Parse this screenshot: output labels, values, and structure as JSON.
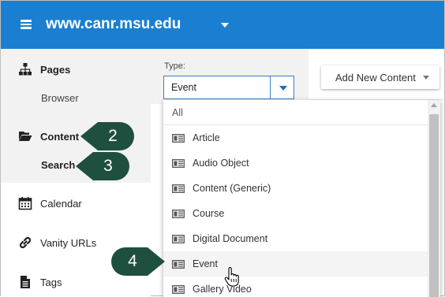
{
  "header": {
    "site_title": "www.canr.msu.edu"
  },
  "sidebar": {
    "items": [
      {
        "label": "Pages",
        "icon": "sitemap-icon"
      },
      {
        "label": "Browser"
      },
      {
        "label": "Content",
        "icon": "folder-open-icon"
      },
      {
        "label": "Search"
      },
      {
        "label": "Calendar",
        "icon": "calendar-icon"
      },
      {
        "label": "Vanity URLs",
        "icon": "link-icon"
      },
      {
        "label": "Tags",
        "icon": "document-icon"
      }
    ]
  },
  "callouts": [
    "2",
    "3",
    "4"
  ],
  "filter": {
    "type_label": "Type:",
    "type_value": "Event"
  },
  "toolbar": {
    "add_new_content_label": "Add New Content"
  },
  "dropdown": {
    "all_label": "All",
    "options": [
      "Article",
      "Audio Object",
      "Content (Generic)",
      "Course",
      "Digital Document",
      "Event",
      "Gallery Video"
    ],
    "hovered_option": "Event"
  },
  "colors": {
    "header_bg": "#1a7fd0",
    "callout_bg": "#1f4f3f",
    "accent_border": "#3a7dc2"
  }
}
